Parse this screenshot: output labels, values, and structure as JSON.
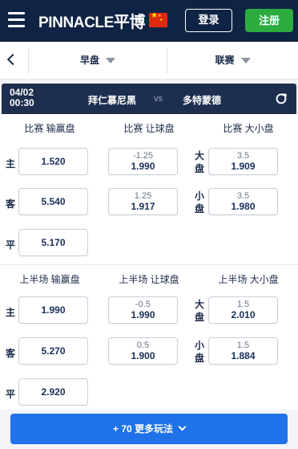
{
  "header": {
    "brand": "PINNACLE",
    "brand_cn": "平博",
    "flag_icon": "china-flag-icon",
    "login_label": "登录",
    "register_label": "注册"
  },
  "filters": {
    "market_type": "早盘",
    "league": "联赛"
  },
  "match": {
    "date": "04/02",
    "time": "00:30",
    "home": "拜仁慕尼黑",
    "vs": "vs",
    "away": "多特蒙德"
  },
  "full_time": {
    "headers": [
      "比赛 输赢盘",
      "比赛 让球盘",
      "比赛 大小盘"
    ],
    "moneyline": {
      "home_label": "主",
      "home": "1.520",
      "away_label": "客",
      "away": "5.540",
      "draw_label": "平",
      "draw": "5.170"
    },
    "handicap": [
      {
        "line": "-1.25",
        "price": "1.990"
      },
      {
        "line": "1.25",
        "price": "1.917"
      }
    ],
    "totals": [
      {
        "label": "大盘",
        "line": "3.5",
        "price": "1.909"
      },
      {
        "label": "小盘",
        "line": "3.5",
        "price": "1.980"
      }
    ]
  },
  "first_half": {
    "headers": [
      "上半场 输赢盘",
      "上半场 让球盘",
      "上半场 大小盘"
    ],
    "moneyline": {
      "home_label": "主",
      "home": "1.990",
      "away_label": "客",
      "away": "5.270",
      "draw_label": "平",
      "draw": "2.920"
    },
    "handicap": [
      {
        "line": "-0.5",
        "price": "1.990"
      },
      {
        "line": "0.5",
        "price": "1.900"
      }
    ],
    "totals": [
      {
        "label": "大盘",
        "line": "1.5",
        "price": "2.010"
      },
      {
        "label": "小盘",
        "line": "1.5",
        "price": "1.884"
      }
    ]
  },
  "more_button": "+ 70 更多玩法"
}
